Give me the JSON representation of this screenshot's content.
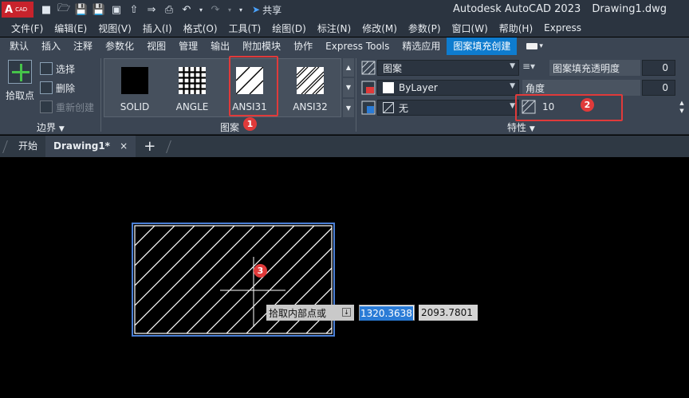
{
  "app": {
    "logo_main": "A",
    "logo_sub": "CAD",
    "title": "Autodesk AutoCAD 2023",
    "document": "Drawing1.dwg",
    "share_label": "共享"
  },
  "menu": [
    "文件(F)",
    "编辑(E)",
    "视图(V)",
    "插入(I)",
    "格式(O)",
    "工具(T)",
    "绘图(D)",
    "标注(N)",
    "修改(M)",
    "参数(P)",
    "窗口(W)",
    "帮助(H)",
    "Express"
  ],
  "ribbon_tabs": [
    "默认",
    "插入",
    "注释",
    "参数化",
    "视图",
    "管理",
    "输出",
    "附加模块",
    "协作",
    "Express Tools",
    "精选应用",
    "图案填充创建"
  ],
  "active_tab_index": 11,
  "boundary_panel": {
    "pick_points_label": "拾取点",
    "select_label": "选择",
    "remove_label": "删除",
    "recreate_label": "重新创建",
    "title": "边界"
  },
  "pattern_panel": {
    "title": "图案",
    "patterns": [
      "SOLID",
      "ANGLE",
      "ANSI31",
      "ANSI32"
    ],
    "selected_pattern": "ANSI31"
  },
  "properties_panel": {
    "title": "特性",
    "hatch_type": "图案",
    "hatch_color": "ByLayer",
    "background_color": "无",
    "transparency_label": "图案填充透明度",
    "transparency_value": "0",
    "angle_label": "角度",
    "angle_value": "0",
    "scale_value": "10"
  },
  "annotations": {
    "badge1": "1",
    "badge2": "2",
    "badge3": "3"
  },
  "file_tabs": {
    "start": "开始",
    "drawing": "Drawing1*",
    "close": "×",
    "new": "+"
  },
  "canvas": {
    "prompt": "拾取内部点或",
    "coord_x": "1320.3638",
    "coord_y": "2093.7801"
  },
  "colors": {
    "accent": "#0e7ccf",
    "highlight": "#e03a3a",
    "selection_outline": "#4a7fd6"
  }
}
